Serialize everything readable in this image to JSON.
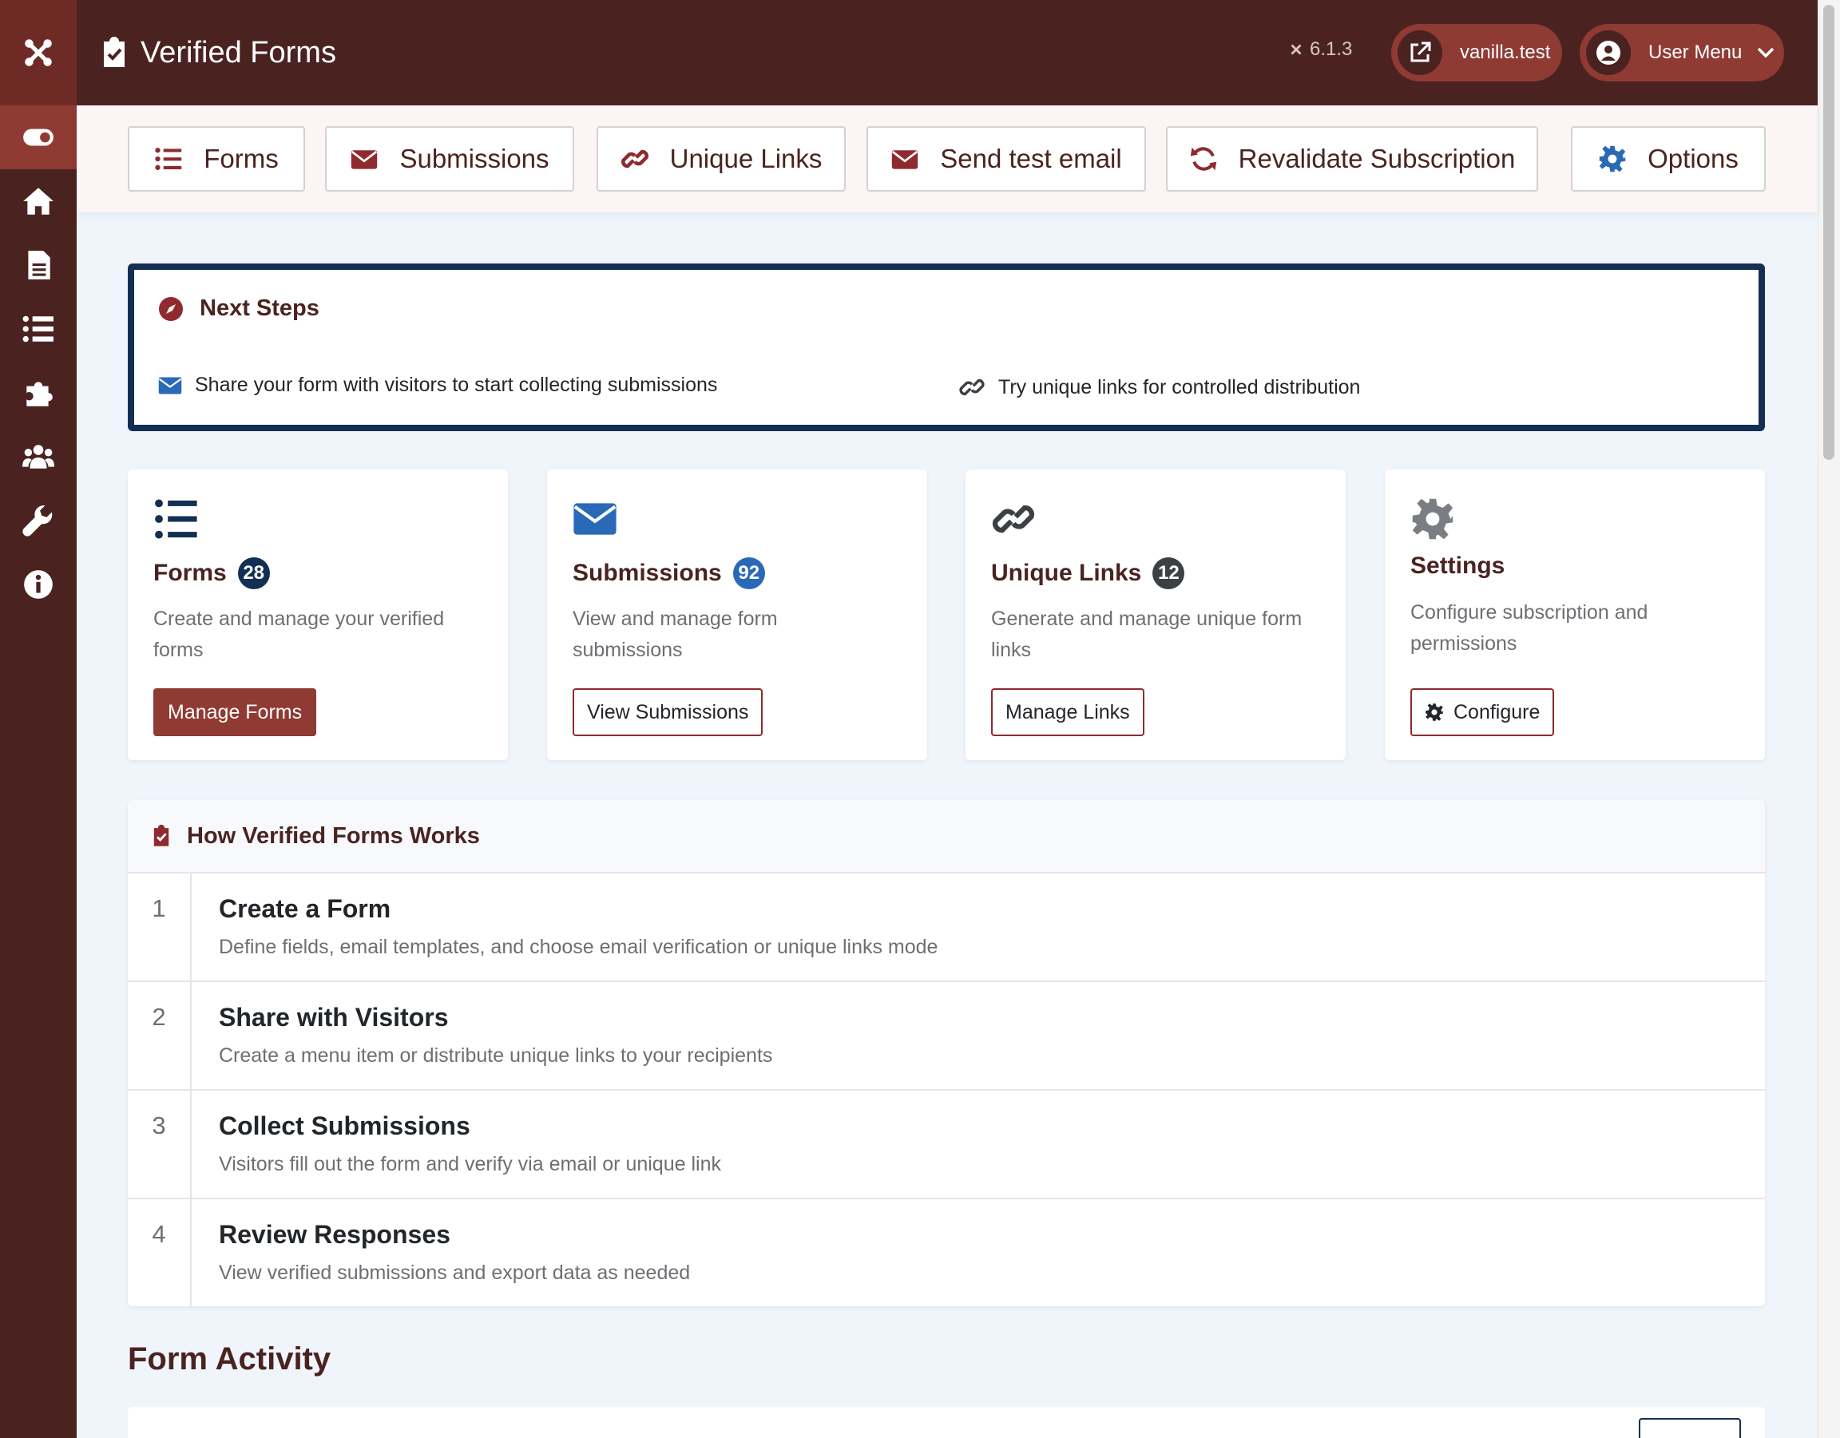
{
  "header": {
    "title": "Verified Forms",
    "version": "6.1.3",
    "site_link": "vanilla.test",
    "user_menu": "User Menu"
  },
  "toolbar": {
    "forms": "Forms",
    "submissions": "Submissions",
    "unique_links": "Unique Links",
    "send_test_email": "Send test email",
    "revalidate": "Revalidate Subscription",
    "options": "Options"
  },
  "next_steps": {
    "title": "Next Steps",
    "step1": "Share your form with visitors to start collecting submissions",
    "step2": "Try unique links for controlled distribution"
  },
  "cards": [
    {
      "title": "Forms",
      "count": "28",
      "desc": "Create and manage your verified forms",
      "button": "Manage Forms"
    },
    {
      "title": "Submissions",
      "count": "92",
      "desc": "View and manage form submissions",
      "button": "View Submissions"
    },
    {
      "title": "Unique Links",
      "count": "12",
      "desc": "Generate and manage unique form links",
      "button": "Manage Links"
    },
    {
      "title": "Settings",
      "desc": "Configure subscription and permissions",
      "button": "Configure"
    }
  ],
  "how": {
    "title": "How Verified Forms Works",
    "steps": [
      {
        "num": "1",
        "title": "Create a Form",
        "desc": "Define fields, email templates, and choose email verification or unique links mode"
      },
      {
        "num": "2",
        "title": "Share with Visitors",
        "desc": "Create a menu item or distribute unique links to your recipients"
      },
      {
        "num": "3",
        "title": "Collect Submissions",
        "desc": "Visitors fill out the form and verify via email or unique link"
      },
      {
        "num": "4",
        "title": "Review Responses",
        "desc": "View verified submissions and export data as needed"
      }
    ]
  },
  "activity_title": "Form Activity",
  "colors": {
    "brand_dark": "#4a2320",
    "brand": "#8f3a33",
    "accent_red": "#8f2a2f",
    "navy": "#132f53",
    "blue_badge": "#2a69b8",
    "gray_badge": "#3c3f44"
  },
  "icons": {
    "sidebar": [
      "joomla-logo-icon",
      "toggle-icon",
      "home-icon",
      "file-icon",
      "list-icon",
      "puzzle-icon",
      "users-icon",
      "wrench-icon",
      "info-icon"
    ]
  }
}
